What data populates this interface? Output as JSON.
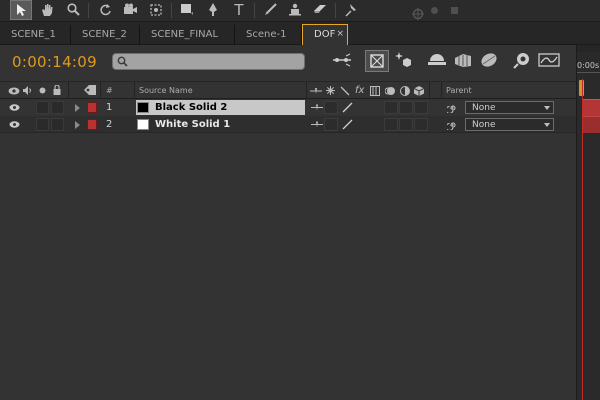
{
  "toolbar": {
    "icons": [
      "selection-tool",
      "hand-tool",
      "zoom-tool",
      "rotation-tool",
      "camera-tool",
      "pan-behind-tool",
      "rectangle-tool",
      "pen-tool",
      "type-tool",
      "brush-tool",
      "puppet-pin-tool",
      "eraser-tool",
      "pin-tool"
    ],
    "type_label": "T"
  },
  "tabs": [
    {
      "label": "SCENE_1"
    },
    {
      "label": "SCENE_2"
    },
    {
      "label": "SCENE_FINAL"
    },
    {
      "label": "Scene-1"
    },
    {
      "label": "DOF",
      "active": true,
      "close": "×"
    }
  ],
  "composition": {
    "timecode": "0:00:14:09",
    "search_placeholder": ""
  },
  "columns": {
    "number": "#",
    "source_name": "Source Name",
    "fx": "fx",
    "parent": "Parent"
  },
  "layers": [
    {
      "number": "1",
      "name": "Black Solid 2",
      "swatch": "#000000",
      "selected": true,
      "parent": "None"
    },
    {
      "number": "2",
      "name": "White Solid 1",
      "swatch": "#ffffff",
      "selected": false,
      "parent": "None"
    }
  ],
  "timeline": {
    "start_label": "0:00s"
  },
  "colors": {
    "accent": "#e8a726",
    "timecode": "#e09a1e",
    "label_red": "#b83232",
    "layer_bar": "#b33535"
  }
}
